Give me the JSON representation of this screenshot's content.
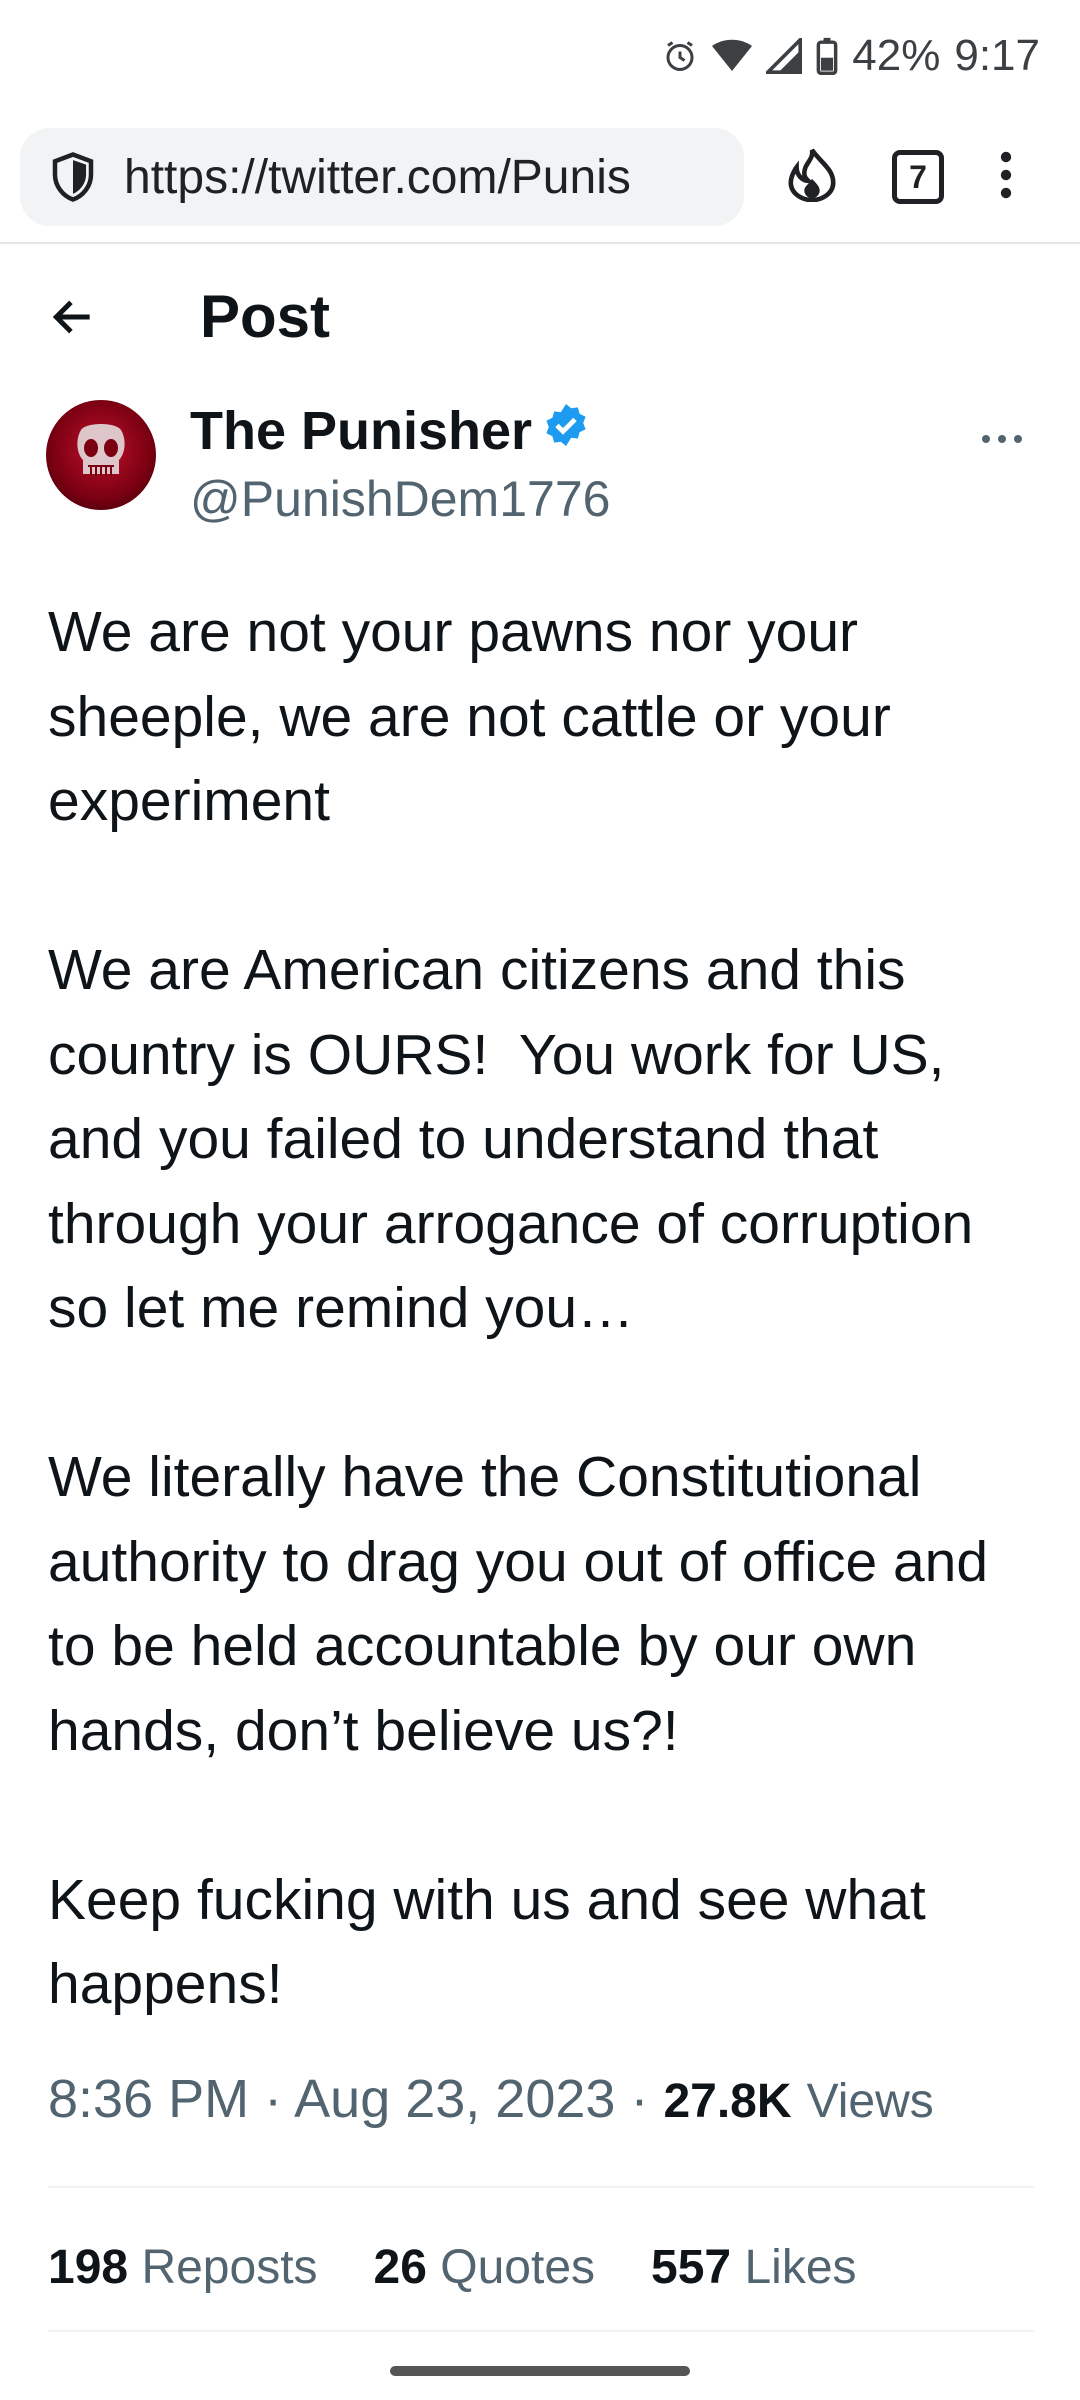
{
  "status_bar": {
    "battery": "42%",
    "time": "9:17"
  },
  "browser": {
    "url": "https://twitter.com/Punis",
    "tab_count": "7"
  },
  "header": {
    "title": "Post"
  },
  "post": {
    "author_name": "The Punisher",
    "author_handle": "@PunishDem1776",
    "text": "We are not your pawns nor your sheeple, we are not cattle or your experiment\n\nWe are American citizens and this country is OURS!  You work for US, and you failed to understand that through your arrogance of corruption so let me remind you…\n\nWe literally have the Constitutional authority to drag you out of office and to be held accountable by our own hands, don’t believe us?!\n\nKeep fucking with us and see what happens!",
    "time": "8:36 PM",
    "date": "Aug 23, 2023",
    "separator": "·",
    "views_count": "27.8K",
    "views_label": "Views"
  },
  "stats": {
    "reposts_count": "198",
    "reposts_label": "Reposts",
    "quotes_count": "26",
    "quotes_label": "Quotes",
    "likes_count": "557",
    "likes_label": "Likes"
  },
  "colors": {
    "verified_blue": "#1d9bf0",
    "secondary_text": "#536471"
  }
}
